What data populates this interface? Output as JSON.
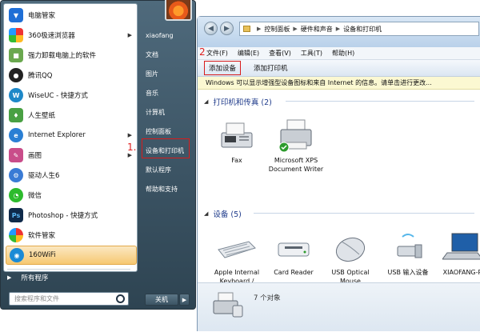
{
  "start_menu": {
    "programs": [
      {
        "label": "电脑管家",
        "icon": "shield-icon",
        "color": "#1f6fd6",
        "has_arrow": false
      },
      {
        "label": "360极速浏览器",
        "icon": "browser-icon",
        "color": "#e0622b",
        "has_arrow": true
      },
      {
        "label": "强力卸载电脑上的软件",
        "icon": "uninstaller-icon",
        "color": "#6aa84f",
        "has_arrow": false
      },
      {
        "label": "腾讯QQ",
        "icon": "qq-penguin-icon",
        "color": "#222222",
        "has_arrow": false
      },
      {
        "label": "WiseUC - 快捷方式",
        "icon": "wiseuc-icon",
        "color": "#1e88c8",
        "has_arrow": false
      },
      {
        "label": "人生壁纸",
        "icon": "wallpaper-icon",
        "color": "#49a043",
        "has_arrow": false
      },
      {
        "label": "Internet Explorer",
        "icon": "ie-icon",
        "color": "#2a7fd4",
        "has_arrow": true
      },
      {
        "label": "画图",
        "icon": "paint-icon",
        "color": "#c94d8a",
        "has_arrow": true
      },
      {
        "label": "驱动人生6",
        "icon": "driver-icon",
        "color": "#3a7bd5",
        "has_arrow": false
      },
      {
        "label": "微信",
        "icon": "wechat-icon",
        "color": "#2dbb2d",
        "has_arrow": false
      },
      {
        "label": "Photoshop - 快捷方式",
        "icon": "photoshop-icon",
        "color": "#0f2a4a",
        "has_arrow": false
      },
      {
        "label": "软件管家",
        "icon": "software-manager-icon",
        "color": "#2b9bd8",
        "has_arrow": false
      },
      {
        "label": "160WiFi",
        "icon": "wifi-icon",
        "color": "#1a8ad6",
        "has_arrow": false
      }
    ],
    "all_programs": "所有程序",
    "search_placeholder": "搜索程序和文件",
    "right_items": [
      "xiaofang",
      "文档",
      "图片",
      "音乐",
      "计算机",
      "控制面板",
      "设备和打印机",
      "默认程序",
      "帮助和支持"
    ],
    "shutdown_label": "关机",
    "marker1": "1."
  },
  "window": {
    "address": [
      "控制面板",
      "硬件和声音",
      "设备和打印机"
    ],
    "menu": [
      "文件(F)",
      "编辑(E)",
      "查看(V)",
      "工具(T)",
      "帮助(H)"
    ],
    "marker2": "2",
    "toolbar": {
      "add_device": "添加设备",
      "add_printer": "添加打印机"
    },
    "info_bar": "Windows 可以显示增强型设备图标和来自 Internet 的信息。请单击进行更改...",
    "groups": {
      "printers": {
        "title": "打印机和传真 (2)",
        "items": [
          {
            "name": "Fax",
            "icon": "fax-icon"
          },
          {
            "name": "Microsoft XPS Document Writer",
            "icon": "printer-icon"
          }
        ]
      },
      "devices": {
        "title": "设备 (5)",
        "items": [
          {
            "name": "Apple Internal Keyboard / Trackpad",
            "icon": "keyboard-icon"
          },
          {
            "name": "Card Reader",
            "icon": "card-reader-icon"
          },
          {
            "name": "USB Optical Mouse",
            "icon": "mouse-icon"
          },
          {
            "name": "USB 输入设备",
            "icon": "usb-device-icon"
          },
          {
            "name": "XIAOFANG-P",
            "icon": "laptop-icon"
          }
        ]
      }
    },
    "status_count": "7 个对象"
  }
}
